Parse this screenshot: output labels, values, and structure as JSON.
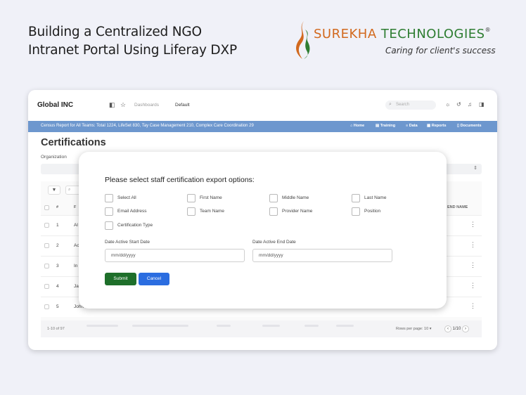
{
  "headline": {
    "line1": "Building a Centralized NGO",
    "line2": "Intranet Portal Using Liferay DXP"
  },
  "logo": {
    "name_part1": "SUREKHA ",
    "name_part2": "TECHNOLOGIES",
    "registered": "®",
    "tagline": "Caring for client's success"
  },
  "app": {
    "title": "Global INC",
    "breadcrumb": [
      "Dashboards",
      "Default"
    ],
    "search_placeholder": "Search",
    "banner_text": "Census Report for All Teams: Total 1224, LifeSet 830, Tay Case Management 210, Complex Care Coordination 29",
    "nav": [
      {
        "label": "Home",
        "icon": "home-icon"
      },
      {
        "label": "Training",
        "icon": "training-icon"
      },
      {
        "label": "Data",
        "icon": "database-icon"
      },
      {
        "label": "Reports",
        "icon": "reports-icon"
      },
      {
        "label": "Documents",
        "icon": "document-icon"
      }
    ]
  },
  "page": {
    "title": "Certifications",
    "organization_label": "Organization",
    "table": {
      "headers": {
        "num": "#",
        "name": "F",
        "end": "END NAME"
      },
      "rows": [
        {
          "num": "1",
          "name": "Al"
        },
        {
          "num": "2",
          "name": "Ac"
        },
        {
          "num": "3",
          "name": "In"
        },
        {
          "num": "4",
          "name": "Ja"
        },
        {
          "num": "5",
          "name": "John"
        }
      ],
      "count_text": "1-10 of 97",
      "rows_per_page": "Rows per page: 10",
      "page_indicator": "1/10"
    }
  },
  "modal": {
    "title": "Please select staff certification export options:",
    "options": [
      "Select All",
      "First Name",
      "Middle Name",
      "Last Name",
      "Email Address",
      "Team Name",
      "Provider Name",
      "Position",
      "Certification Type"
    ],
    "start_label": "Date Active Start Date",
    "end_label": "Date Active End Date",
    "start_placeholder": "mm/dd/yyyy",
    "end_placeholder": "mm/dd/yyyy",
    "submit_label": "Submit",
    "cancel_label": "Cancel"
  },
  "colors": {
    "banner": "#6d97ce",
    "submit": "#1e6f2a",
    "cancel": "#2b6de0",
    "logo_orange": "#d2691e",
    "logo_green": "#2e7d32"
  }
}
